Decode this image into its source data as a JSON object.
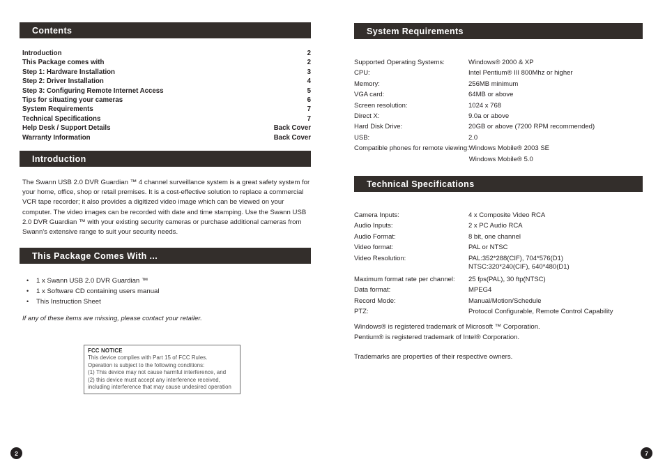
{
  "document": {
    "left_page": {
      "page_number": "2",
      "sections": {
        "contents": {
          "heading": "Contents",
          "entries": [
            {
              "title": "Introduction",
              "page": "2"
            },
            {
              "title": "This Package comes with",
              "page": "2"
            },
            {
              "title": "Step 1: Hardware Installation",
              "page": "3"
            },
            {
              "title": "Step 2: Driver Installation",
              "page": "4"
            },
            {
              "title": "Step 3: Configuring Remote Internet Access",
              "page": "5"
            },
            {
              "title": "Tips for situating your cameras",
              "page": "6"
            },
            {
              "title": "System Requirements",
              "page": "7"
            },
            {
              "title": "Technical Specifications",
              "page": "7"
            },
            {
              "title": "Help Desk / Support Details",
              "page": "Back Cover"
            },
            {
              "title": "Warranty Information",
              "page": "Back Cover"
            }
          ]
        },
        "introduction": {
          "heading": "Introduction",
          "body": "The Swann USB 2.0 DVR Guardian ™ 4 channel surveillance system is a great safety system for your home, office, shop or retail premises. It is a cost-effective solution to replace a commercial VCR tape recorder; it also provides a digitized video image which can be viewed on your computer. The video images can be recorded with date and time stamping. Use the Swann USB 2.0 DVR Guardian ™ with your existing security cameras or purchase additional cameras from Swann's extensive range to suit your security needs."
        },
        "package": {
          "heading": "This Package Comes With ...",
          "bullet_glyph": "•",
          "items": [
            "1 x Swann USB 2.0 DVR Guardian ™",
            "1 x Software CD containing users manual",
            "This Instruction Sheet"
          ],
          "note": "If any of these items are missing, please contact your retailer."
        },
        "fcc": {
          "title": "FCC NOTICE",
          "lines": [
            "This device complies with Part 15 of FCC Rules.",
            "Operation is subject to the following conditions:",
            "(1) This device may not cause harmful interference, and",
            "(2) this device must accept any interference received,",
            "including interference that may cause undesired operation"
          ]
        }
      }
    },
    "right_page": {
      "page_number": "7",
      "sections": {
        "system_requirements": {
          "heading": "System Requirements",
          "rows": [
            {
              "label": "Supported Operating Systems:",
              "value": "Windows® 2000 & XP"
            },
            {
              "label": "CPU:",
              "value": "Intel Pentium® III 800Mhz or higher"
            },
            {
              "label": "Memory:",
              "value": "256MB minimum"
            },
            {
              "label": "VGA card:",
              "value": "64MB or above"
            },
            {
              "label": "Screen resolution:",
              "value": "1024 x 768"
            },
            {
              "label": "Direct X:",
              "value": "9.0a or above"
            },
            {
              "label": "Hard Disk Drive:",
              "value": "20GB or above (7200 RPM recommended)"
            },
            {
              "label": "USB:",
              "value": "2.0"
            },
            {
              "label": "Compatible phones for remote viewing:",
              "value": "Windows Mobile® 2003 SE",
              "value2": "Windows Mobile® 5.0"
            }
          ]
        },
        "technical_specifications": {
          "heading": "Technical Specifications",
          "rows": [
            {
              "label": "Camera Inputs:",
              "value": "4 x Composite Video RCA"
            },
            {
              "label": "Audio Inputs:",
              "value": "2 x PC Audio RCA"
            },
            {
              "label": "Audio Format:",
              "value": "8 bit, one channel"
            },
            {
              "label": "Video format:",
              "value": "PAL or NTSC"
            },
            {
              "label": "Video Resolution:",
              "value": "PAL:352*288(CIF), 704*576(D1)",
              "value2": "NTSC:320*240(CIF), 640*480(D1)"
            },
            {
              "label": "Maximum format rate per channel:",
              "value": "25 fps(PAL), 30 ftp(NTSC)"
            },
            {
              "label": "Data format:",
              "value": "MPEG4"
            },
            {
              "label": "Record Mode:",
              "value": "Manual/Motion/Schedule"
            },
            {
              "label": "PTZ:",
              "value": "Protocol Configurable, Remote Control Capability"
            }
          ]
        },
        "trademarks": {
          "line1": "Windows® is registered trademark of Microsoft ™ Corporation.",
          "line2": "Pentium® is registered trademark of Intel® Corporation.",
          "line3": "Trademarks are properties of their respective owners."
        }
      }
    }
  },
  "theme": {
    "header_bar_color": "#332e2b",
    "text_color": "#231f20",
    "page_background": "#ffffff",
    "fcc_border_color": "#6a6a6a"
  }
}
